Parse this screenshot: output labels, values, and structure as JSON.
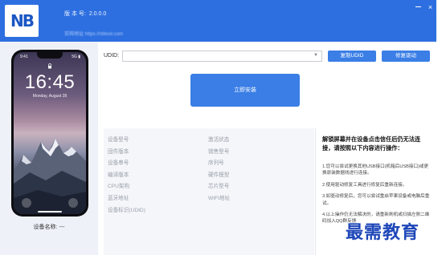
{
  "header": {
    "logo_text": "NB",
    "version_label": "版 本 号:",
    "version_value": "2.0.0.0",
    "site_text": "官网地址 https://nbtool.com"
  },
  "phone": {
    "status_left": "9:41",
    "status_right": "5G ▮",
    "lock_time": "16:45",
    "lock_date": "Monday, August 28",
    "device_name_label": "设备名称:",
    "device_name_value": "---"
  },
  "udid": {
    "label": "UDID:",
    "value": ""
  },
  "buttons": {
    "copy_udid": "复制UDID",
    "repair_driver": "修复驱动",
    "install_now": "立即安装"
  },
  "info": {
    "left_column": [
      "设备型号",
      "固件版本",
      "设备串号",
      "编译版本",
      "CPU架构",
      "蓝牙地址",
      "设备标识(UDID)"
    ],
    "right_column": [
      "激活状态",
      "销售型号",
      "序列号",
      "硬件模型",
      "芯片型号",
      "WIFI地址"
    ]
  },
  "help": {
    "title": "解锁屏幕并在设备点击信任后仍无法连接，请按照以下内容进行操作：",
    "steps": [
      "1.您可以尝试更换其他USB接口(机箱后USB接口)或更换原装数据线进行连接。",
      "2.使用驱动修复工具进行修复后重新连接。",
      "3.如驱动修复后，您可以尝试重启苹果设备或电脑后重试。",
      "4.以上操作仍无法解决的，请重新刷机或扫描左侧二维码加入QQ群反馈"
    ]
  },
  "watermark": "最需教育",
  "colors": {
    "brand_blue": "#2d6fe0",
    "button_blue": "#3a7ee6",
    "panel_gray": "#f4f6fa"
  }
}
